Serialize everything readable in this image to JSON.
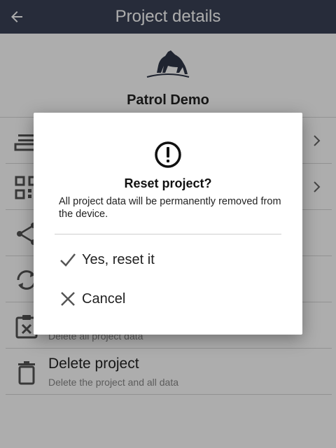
{
  "appbar": {
    "title": "Project details"
  },
  "project": {
    "name": "Patrol Demo"
  },
  "rows": [
    {
      "title": "",
      "subtitle": ""
    },
    {
      "title": "",
      "subtitle": ""
    },
    {
      "title": "",
      "subtitle": ""
    },
    {
      "title": "",
      "subtitle": ""
    },
    {
      "title": "",
      "subtitle": "Delete all project data"
    },
    {
      "title": "Delete project",
      "subtitle": "Delete the project and all data"
    }
  ],
  "dialog": {
    "title": "Reset project?",
    "message": "All project data will be permanently removed from the device.",
    "confirm_label": "Yes, reset it",
    "cancel_label": "Cancel"
  },
  "colors": {
    "appbar": "#3a4256",
    "icon": "#555555"
  }
}
